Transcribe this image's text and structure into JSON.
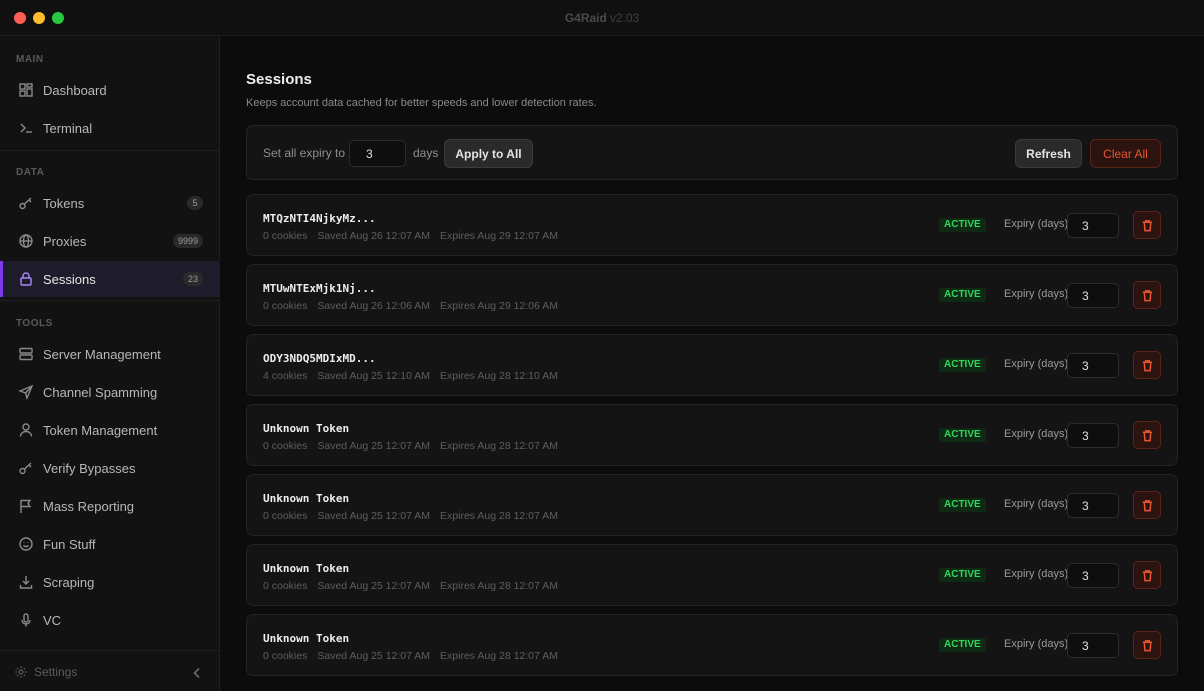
{
  "window": {
    "title": "G4Raid",
    "version": "v2.03"
  },
  "sidebar": {
    "sections": {
      "main": "MAIN",
      "data": "DATA",
      "tools": "TOOLS"
    },
    "main_items": [
      {
        "label": "Dashboard",
        "icon": "dashboard-icon"
      },
      {
        "label": "Terminal",
        "icon": "terminal-icon"
      }
    ],
    "data_items": [
      {
        "label": "Tokens",
        "icon": "key-icon",
        "badge": "5"
      },
      {
        "label": "Proxies",
        "icon": "globe-icon",
        "badge": "9999"
      },
      {
        "label": "Sessions",
        "icon": "lock-icon",
        "badge": "23",
        "active": true
      }
    ],
    "tool_items": [
      {
        "label": "Server Management",
        "icon": "server-icon"
      },
      {
        "label": "Channel Spamming",
        "icon": "send-icon"
      },
      {
        "label": "Token Management",
        "icon": "user-icon"
      },
      {
        "label": "Verify Bypasses",
        "icon": "key-icon"
      },
      {
        "label": "Mass Reporting",
        "icon": "flag-icon"
      },
      {
        "label": "Fun Stuff",
        "icon": "smile-icon"
      },
      {
        "label": "Scraping",
        "icon": "download-icon"
      },
      {
        "label": "VC",
        "icon": "microphone-icon"
      }
    ],
    "settings_label": "Settings"
  },
  "main": {
    "title": "Sessions",
    "subtitle": "Keeps account data cached for better speeds and lower detection rates.",
    "controls": {
      "set_all_label": "Set all expiry to",
      "expiry_value": "3",
      "days_label": "days",
      "apply_label": "Apply to All",
      "refresh_label": "Refresh",
      "clear_label": "Clear All"
    },
    "sessions": [
      {
        "token": "MTQzNTI4NjkyMz...",
        "cookies": "0 cookies",
        "saved": "Saved Aug 26 12:07 AM",
        "expires": "Expires Aug 29 12:07 AM",
        "status": "ACTIVE",
        "expiry_label": "Expiry (days)",
        "expiry": "3"
      },
      {
        "token": "MTUwNTExMjk1Nj...",
        "cookies": "0 cookies",
        "saved": "Saved Aug 26 12:06 AM",
        "expires": "Expires Aug 29 12:06 AM",
        "status": "ACTIVE",
        "expiry_label": "Expiry (days)",
        "expiry": "3"
      },
      {
        "token": "ODY3NDQ5MDIxMD...",
        "cookies": "4 cookies",
        "saved": "Saved Aug 25 12:10 AM",
        "expires": "Expires Aug 28 12:10 AM",
        "status": "ACTIVE",
        "expiry_label": "Expiry (days)",
        "expiry": "3"
      },
      {
        "token": "Unknown Token",
        "cookies": "0 cookies",
        "saved": "Saved Aug 25 12:07 AM",
        "expires": "Expires Aug 28 12:07 AM",
        "status": "ACTIVE",
        "expiry_label": "Expiry (days)",
        "expiry": "3"
      },
      {
        "token": "Unknown Token",
        "cookies": "0 cookies",
        "saved": "Saved Aug 25 12:07 AM",
        "expires": "Expires Aug 28 12:07 AM",
        "status": "ACTIVE",
        "expiry_label": "Expiry (days)",
        "expiry": "3"
      },
      {
        "token": "Unknown Token",
        "cookies": "0 cookies",
        "saved": "Saved Aug 25 12:07 AM",
        "expires": "Expires Aug 28 12:07 AM",
        "status": "ACTIVE",
        "expiry_label": "Expiry (days)",
        "expiry": "3"
      },
      {
        "token": "Unknown Token",
        "cookies": "0 cookies",
        "saved": "Saved Aug 25 12:07 AM",
        "expires": "Expires Aug 28 12:07 AM",
        "status": "ACTIVE",
        "expiry_label": "Expiry (days)",
        "expiry": "3"
      }
    ]
  },
  "colors": {
    "accent": "#7c3aed",
    "danger": "#e8552e",
    "active_status": "#2fd85a",
    "background": "#0c0c0c"
  }
}
